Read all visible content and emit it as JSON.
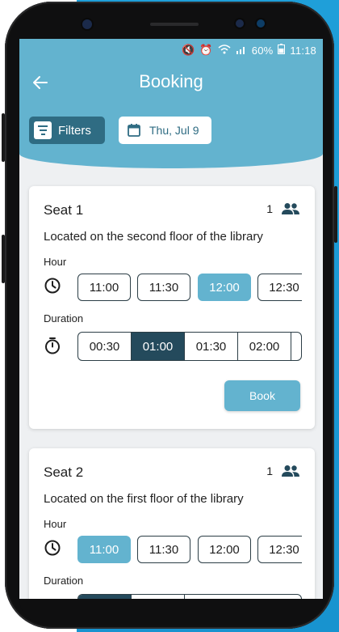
{
  "status_bar": {
    "battery": "60%",
    "time": "11:18"
  },
  "header": {
    "title": "Booking",
    "back_icon": "arrow-left-icon"
  },
  "filters": {
    "label": "Filters",
    "icon": "filter-list-icon"
  },
  "date": {
    "label": "Thu, Jul 9",
    "icon": "calendar-icon"
  },
  "cards": [
    {
      "name": "Seat 1",
      "capacity": "1",
      "description": "Located on the second floor of the library",
      "hour_label": "Hour",
      "hours": [
        "11:00",
        "11:30",
        "12:00",
        "12:30"
      ],
      "selected_hour": "12:00",
      "duration_label": "Duration",
      "durations": [
        "00:30",
        "01:00",
        "01:30",
        "02:00"
      ],
      "selected_duration": "01:00",
      "book_label": "Book"
    },
    {
      "name": "Seat 2",
      "capacity": "1",
      "description": "Located on the first floor of the library",
      "hour_label": "Hour",
      "hours": [
        "11:00",
        "11:30",
        "12:00",
        "12:30"
      ],
      "selected_hour": "11:00",
      "duration_label": "Duration"
    }
  ],
  "colors": {
    "header": "#63b3cf",
    "accent_dark": "#2f6c83",
    "selected_duration": "#244a5c",
    "background_blue": "#1f9fd9"
  }
}
